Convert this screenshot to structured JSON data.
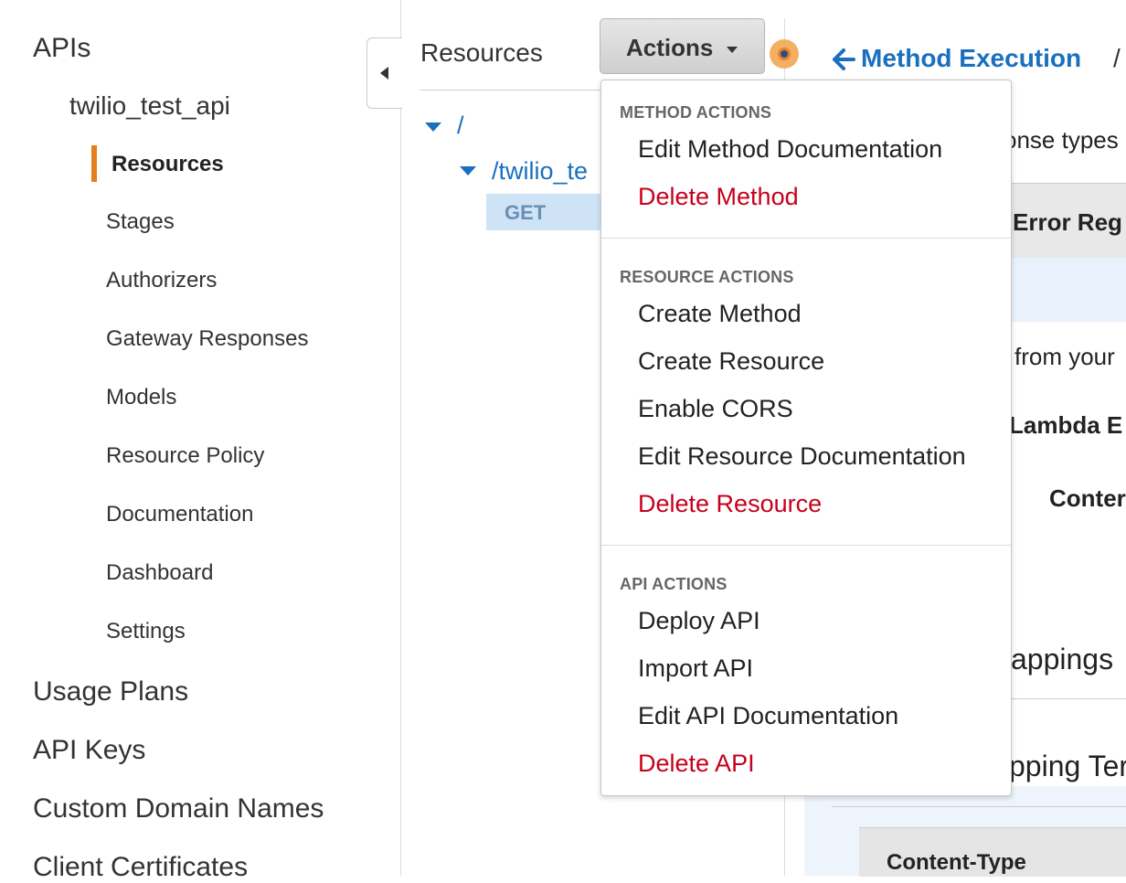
{
  "sidebar": {
    "apis": "APIs",
    "api_name": "twilio_test_api",
    "active": "Resources",
    "items": [
      "Stages",
      "Authorizers",
      "Gateway Responses",
      "Models",
      "Resource Policy",
      "Documentation",
      "Dashboard",
      "Settings"
    ],
    "bottom": [
      "Usage Plans",
      "API Keys",
      "Custom Domain Names",
      "Client Certificates"
    ]
  },
  "resources": {
    "title": "Resources",
    "root": "/",
    "child": "/twilio_te",
    "method": "GET"
  },
  "actions_button": {
    "label": "Actions"
  },
  "header": {
    "method_execution": "Method Execution",
    "slash": "/"
  },
  "right_content": {
    "onse_types": "onse types",
    "error_reg": "Error Reg",
    "from_your": "from your",
    "lambda": "Lambda E",
    "conter": "Conter",
    "appings": "appings",
    "pping_ter": "pping Ter",
    "content_type": "Content-Type"
  },
  "dropdown": {
    "sections": [
      {
        "heading": "METHOD ACTIONS",
        "items": [
          {
            "label": "Edit Method Documentation",
            "danger": false
          },
          {
            "label": "Delete Method",
            "danger": true
          }
        ]
      },
      {
        "heading": "RESOURCE ACTIONS",
        "items": [
          {
            "label": "Create Method",
            "danger": false
          },
          {
            "label": "Create Resource",
            "danger": false
          },
          {
            "label": "Enable CORS",
            "danger": false
          },
          {
            "label": "Edit Resource Documentation",
            "danger": false
          },
          {
            "label": "Delete Resource",
            "danger": true
          }
        ]
      },
      {
        "heading": "API ACTIONS",
        "items": [
          {
            "label": "Deploy API",
            "danger": false
          },
          {
            "label": "Import API",
            "danger": false
          },
          {
            "label": "Edit API Documentation",
            "danger": false
          },
          {
            "label": "Delete API",
            "danger": true
          }
        ]
      }
    ]
  },
  "colors": {
    "accent": "#e37f1c",
    "link": "#1a6fbf",
    "danger": "#c7001b"
  }
}
